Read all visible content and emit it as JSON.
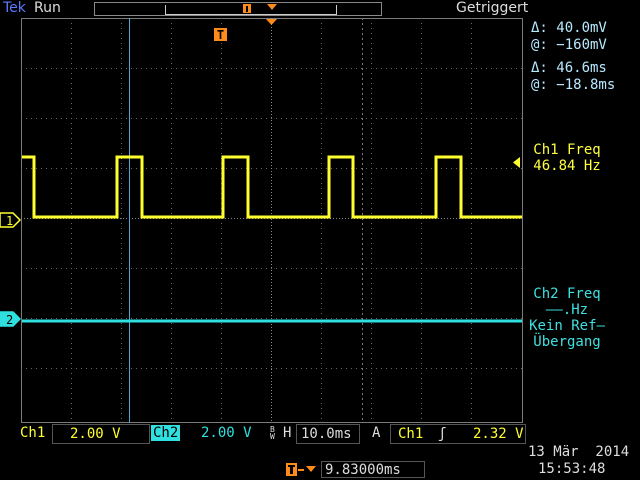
{
  "header": {
    "brand": "Tek",
    "state": "Run",
    "trigger_status": "Getriggert"
  },
  "cursor": {
    "delta_v": "Δ:  40.0mV",
    "at_v": "@: −160mV",
    "delta_t": "Δ:  46.6ms",
    "at_t": "@: −18.8ms"
  },
  "measurements": {
    "ch1_title": "Ch1 Freq",
    "ch1_value": "46.84 Hz",
    "ch2_title": "Ch2 Freq",
    "ch2_value": "——.Hz",
    "ch2_note1": "Kein Ref–",
    "ch2_note2": "Übergang"
  },
  "markers": {
    "trigger": "T",
    "ch1": "1",
    "ch2": "2"
  },
  "status_bar": {
    "ch1_label": "Ch1",
    "ch1_scale": "2.00 V",
    "ch2_label": "Ch2",
    "ch2_scale": "2.00 V",
    "bw": "B\nW",
    "h_label": "H",
    "timebase": "10.0ms",
    "acq": "A",
    "trig_src": "Ch1",
    "trig_slope": "ʃ",
    "trig_level": "2.32 V",
    "trig_pos": "9.83000ms",
    "date": "13 Mär  2014",
    "time": "15:53:48"
  },
  "colors": {
    "ch1": "#ffff30",
    "ch2": "#30e0e0",
    "trigger": "#ff8c1a",
    "grid": "#7a7a7a",
    "cursor": "#50a8d8"
  }
}
